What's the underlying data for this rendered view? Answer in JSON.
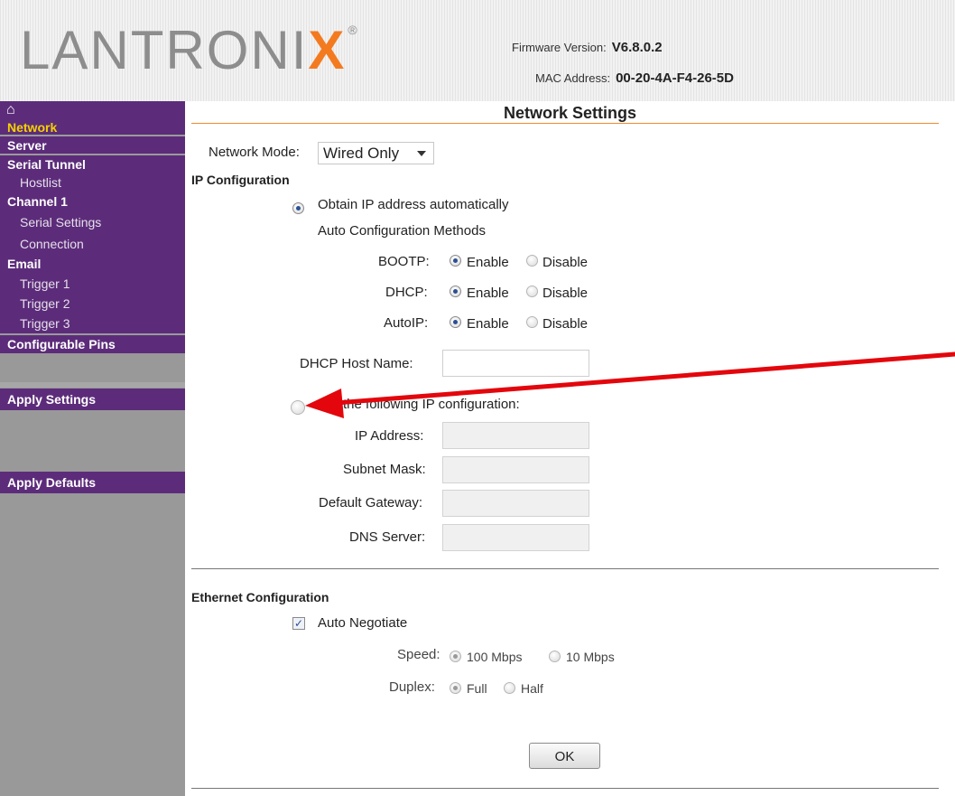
{
  "header": {
    "logo_text_a": "LANTRONI",
    "logo_text_b": "X",
    "logo_reg": "®",
    "firmware_label": "Firmware Version:",
    "firmware_value": "V6.8.0.2",
    "mac_label": "MAC Address:",
    "mac_value": "00-20-4A-F4-26-5D"
  },
  "sidebar": {
    "home_icon": "home-icon",
    "items": [
      {
        "label": "Network"
      },
      {
        "label": "Server"
      },
      {
        "label": "Serial Tunnel"
      },
      {
        "label": "Hostlist"
      },
      {
        "label": "Channel 1"
      },
      {
        "label": "Serial Settings"
      },
      {
        "label": "Connection"
      },
      {
        "label": "Email"
      },
      {
        "label": "Trigger 1"
      },
      {
        "label": "Trigger 2"
      },
      {
        "label": "Trigger 3"
      },
      {
        "label": "Configurable Pins"
      }
    ],
    "apply_settings": "Apply Settings",
    "apply_defaults": "Apply Defaults"
  },
  "main": {
    "title": "Network Settings",
    "network_mode_label": "Network Mode:",
    "network_mode_value": "Wired Only",
    "ip_config_heading": "IP Configuration",
    "obtain_auto_label": "Obtain IP address automatically",
    "auto_methods_label": "Auto Configuration Methods",
    "bootp_label": "BOOTP:",
    "dhcp_label": "DHCP:",
    "autoip_label": "AutoIP:",
    "enable_label": "Enable",
    "disable_label": "Disable",
    "dhcp_host_label": "DHCP Host Name:",
    "use_following_label": "se the following IP configuration:",
    "ip_address_label": "IP Address:",
    "subnet_mask_label": "Subnet Mask:",
    "default_gateway_label": "Default Gateway:",
    "dns_server_label": "DNS Server:",
    "ethernet_heading": "Ethernet Configuration",
    "auto_negotiate_label": "Auto Negotiate",
    "speed_label": "Speed:",
    "speed_100": "100 Mbps",
    "speed_10": "10 Mbps",
    "duplex_label": "Duplex:",
    "duplex_full": "Full",
    "duplex_half": "Half",
    "ok_label": "OK",
    "checkmark": "✓"
  },
  "colors": {
    "purple": "#5c2c7a",
    "active_nav": "#f5d000",
    "title_rule": "#f28a2e",
    "annotation_arrow": "#e3060c",
    "logo_x": "#f47a20"
  }
}
